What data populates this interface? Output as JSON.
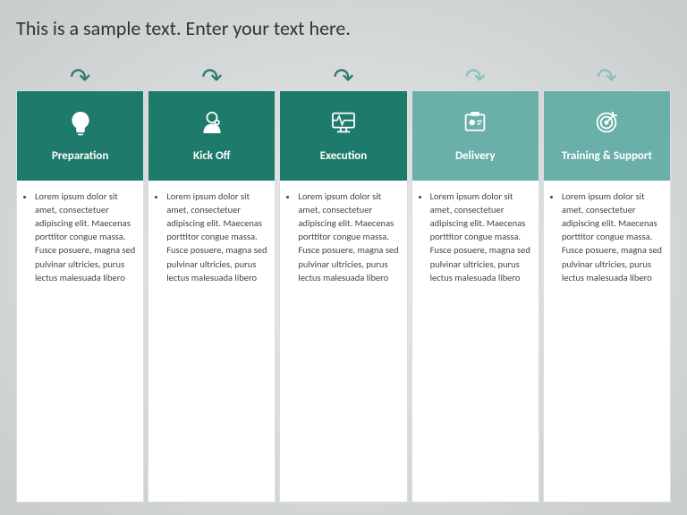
{
  "title": "This is a sample text. Enter your text here.",
  "columns": [
    {
      "id": "preparation",
      "label": "Preparation",
      "icon": "bulb",
      "lighter": false,
      "body_text": "Lorem ipsum dolor sit amet, consectetuer adipiscing elit. Maecenas porttitor congue massa. Fusce posuere, magna sed pulvinar ultricies, purus lectus malesuada libero"
    },
    {
      "id": "kickoff",
      "label": "Kick Off",
      "icon": "head-gear",
      "lighter": false,
      "body_text": "Lorem ipsum dolor sit amet, consectetuer adipiscing elit. Maecenas porttitor congue massa. Fusce posuere, magna sed pulvinar ultricies, purus lectus malesuada libero"
    },
    {
      "id": "execution",
      "label": "Execution",
      "icon": "monitor-pulse",
      "lighter": false,
      "body_text": "Lorem ipsum dolor sit amet, consectetuer adipiscing elit. Maecenas porttitor congue massa. Fusce posuere, magna sed pulvinar ultricies, purus lectus malesuada libero"
    },
    {
      "id": "delivery",
      "label": "Delivery",
      "icon": "badge",
      "lighter": true,
      "body_text": "Lorem ipsum dolor sit amet, consectetuer adipiscing elit. Maecenas porttitor congue massa. Fusce posuere, magna sed pulvinar ultricies, purus lectus malesuada libero"
    },
    {
      "id": "training-support",
      "label": "Training & Support",
      "icon": "target",
      "lighter": true,
      "body_text": "Lorem ipsum dolor sit amet, consectetuer adipiscing elit. Maecenas porttitor congue massa. Fusce posuere, magna sed pulvinar ultricies, purus lectus malesuada libero"
    }
  ],
  "arrow_count": 5,
  "colors": {
    "dark_teal": "#1e7a6a",
    "light_teal": "#6ab0a8",
    "arrow_dark": "#2d7a6e",
    "arrow_light": "#8dbfba"
  }
}
